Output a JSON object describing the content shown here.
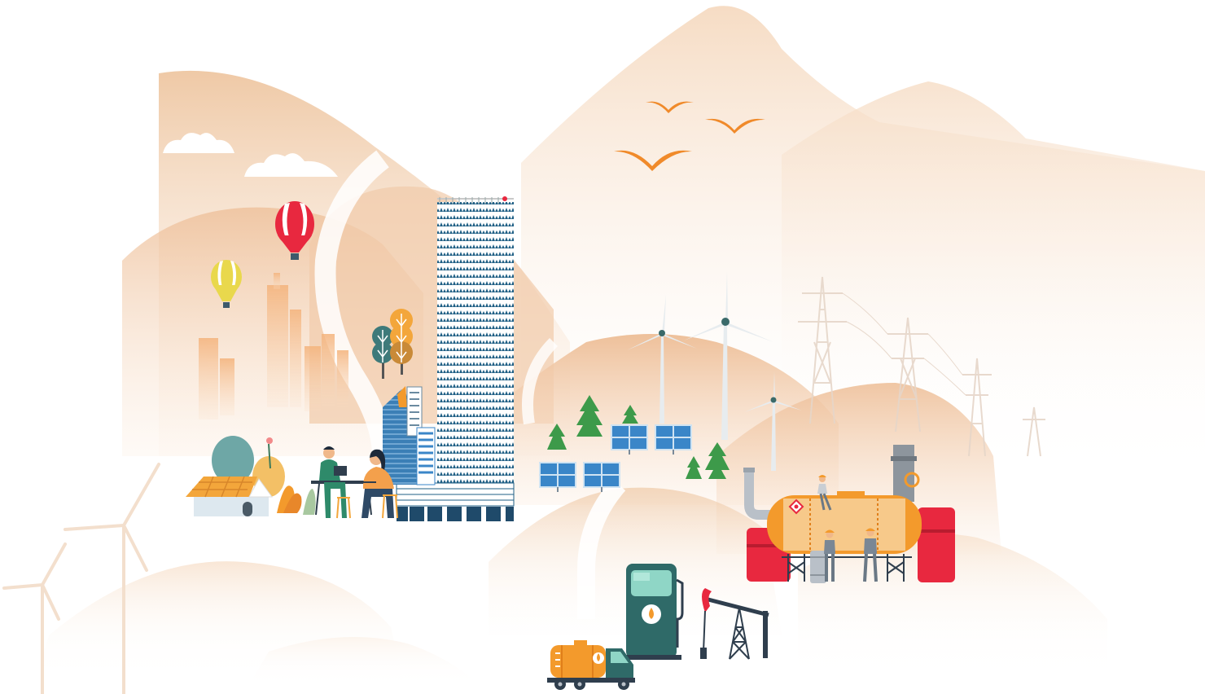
{
  "scene": {
    "description_free": true,
    "colors": {
      "sand": "#f3d6bd",
      "sand_light": "#fae9da",
      "sand_dark": "#e9b98f",
      "orange": "#f39a2c",
      "bird": "#f08a2a",
      "tower_blue": "#1f5f85",
      "teal": "#2e6e6a",
      "green": "#3d9a4a",
      "red": "#e8283f",
      "solar": "#3a86c8",
      "pylon": "#e6d6c9"
    },
    "icons": [
      "hot-air-balloon-icon",
      "bird-icon",
      "wind-turbine-icon",
      "solar-panel-icon",
      "fuel-pump-icon",
      "oil-pumpjack-icon",
      "tanker-truck-icon",
      "storage-tank-icon",
      "house-icon",
      "skyscraper-icon",
      "tree-icon",
      "power-pylon-icon",
      "worker-icon"
    ]
  }
}
